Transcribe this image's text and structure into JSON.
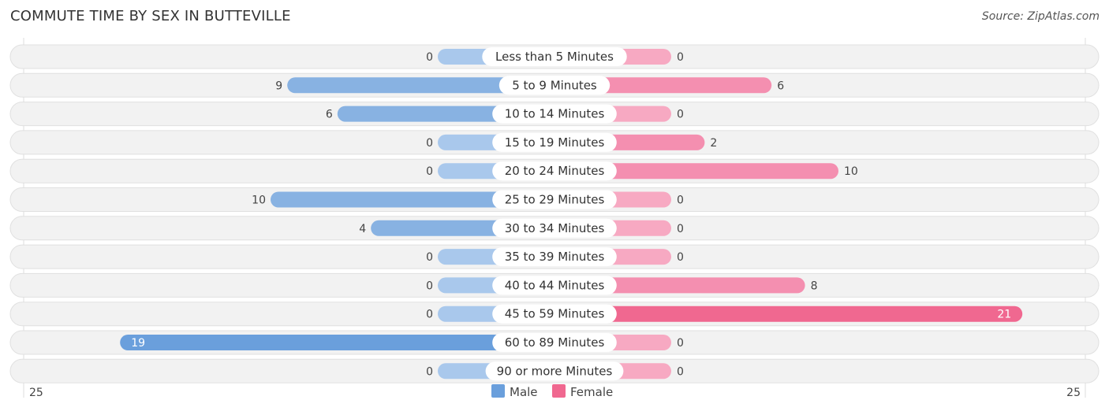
{
  "header": {
    "title": "COMMUTE TIME BY SEX IN BUTTEVILLE",
    "source": "Source: ZipAtlas.com"
  },
  "chart_data": {
    "type": "bar",
    "orientation": "horizontal-diverging",
    "title": "COMMUTE TIME BY SEX IN BUTTEVILLE",
    "categories": [
      "Less than 5 Minutes",
      "5 to 9 Minutes",
      "10 to 14 Minutes",
      "15 to 19 Minutes",
      "20 to 24 Minutes",
      "25 to 29 Minutes",
      "30 to 34 Minutes",
      "35 to 39 Minutes",
      "40 to 44 Minutes",
      "45 to 59 Minutes",
      "60 to 89 Minutes",
      "90 or more Minutes"
    ],
    "series": [
      {
        "name": "Male",
        "color": "#6a9fdc",
        "light_color": "#a9c8ec",
        "values": [
          0,
          9,
          6,
          0,
          0,
          10,
          4,
          0,
          0,
          0,
          19,
          0
        ]
      },
      {
        "name": "Female",
        "color": "#f06890",
        "light_color": "#f7a9c2",
        "values": [
          0,
          6,
          0,
          2,
          10,
          0,
          0,
          0,
          8,
          21,
          0,
          0
        ]
      }
    ],
    "axis": {
      "left_tick": "25",
      "right_tick": "25",
      "max": 25
    },
    "legend": {
      "placement": "bottom-center",
      "items": [
        "Male",
        "Female"
      ]
    }
  }
}
